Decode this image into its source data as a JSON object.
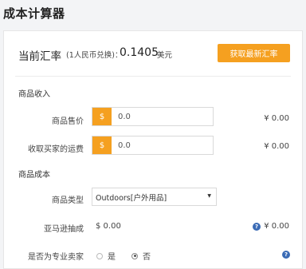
{
  "page": {
    "title": "成本计算器"
  },
  "rate": {
    "label": "当前汇率",
    "note": "(1人民币兑换)：",
    "value": "0.1405",
    "unit": "美元",
    "button_label": "获取最新汇率"
  },
  "income": {
    "section_label": "商品收入",
    "price": {
      "label": "商品售价",
      "currency_symbol": "$",
      "value": "0.0",
      "converted": "¥ 0.00"
    },
    "shipping": {
      "label": "收取买家的运费",
      "currency_symbol": "$",
      "value": "0.0",
      "converted": "¥ 0.00"
    }
  },
  "cost": {
    "section_label": "商品成本",
    "category": {
      "label": "商品类型",
      "selected": "Outdoors[户外用品]"
    },
    "commission": {
      "label": "亚马逊抽成",
      "value": "$ 0.00",
      "converted": "¥ 0.00"
    },
    "pro_seller": {
      "label": "是否为专业卖家",
      "options": [
        "是",
        "否"
      ],
      "selected": "否"
    }
  },
  "colors": {
    "accent": "#f5a020",
    "help": "#3a6bb5"
  }
}
